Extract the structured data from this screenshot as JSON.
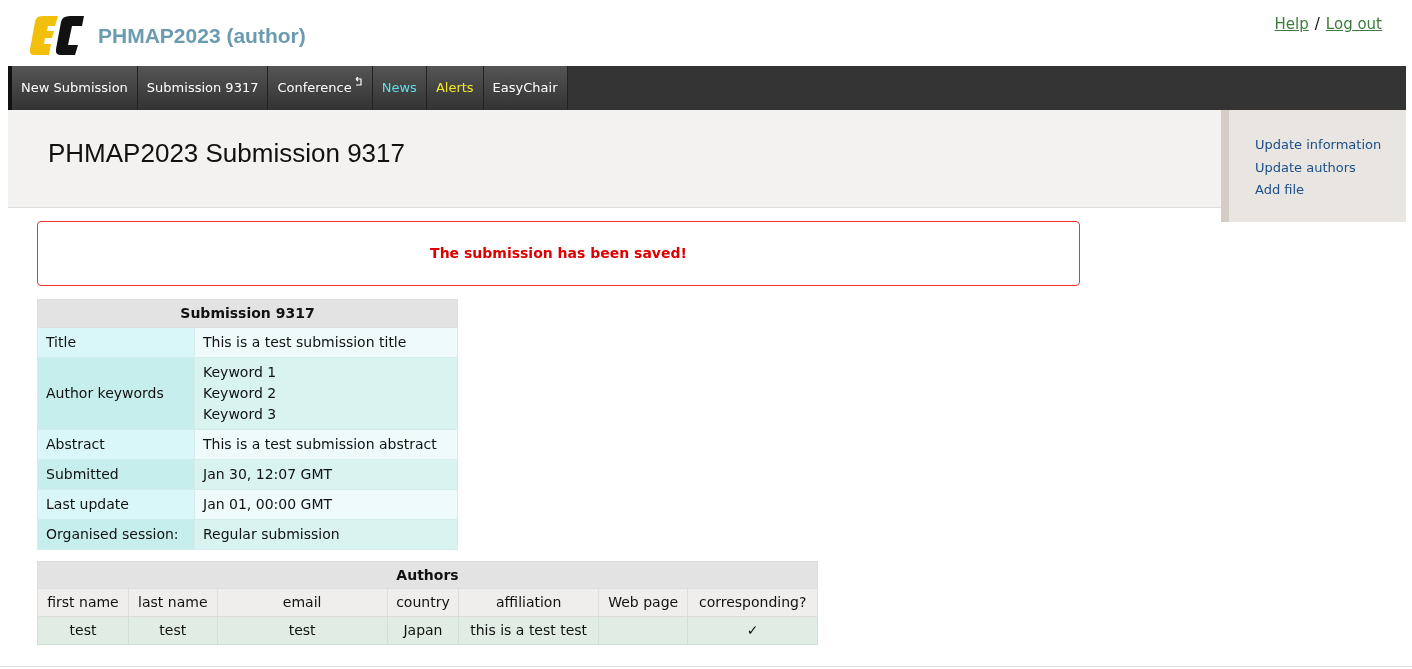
{
  "header": {
    "title": "PHMAP2023 (author)",
    "links": [
      "Help",
      "Log out"
    ],
    "separator": "/"
  },
  "nav": [
    {
      "label": "New Submission",
      "kind": "plain"
    },
    {
      "label": "Submission 9317",
      "kind": "plain"
    },
    {
      "label": "Conference",
      "kind": "return"
    },
    {
      "label": "News",
      "kind": "news"
    },
    {
      "label": "Alerts",
      "kind": "alerts"
    },
    {
      "label": "EasyChair",
      "kind": "plain"
    }
  ],
  "page_title": "PHMAP2023 Submission 9317",
  "side_menu": [
    "Update information",
    "Update authors",
    "Add file"
  ],
  "notice": "The submission has been saved!",
  "info_table": {
    "title": "Submission 9317",
    "rows": [
      {
        "label": "Title",
        "values": [
          "This is a test submission title"
        ]
      },
      {
        "label": "Author keywords",
        "values": [
          "Keyword 1",
          "Keyword 2",
          "Keyword 3"
        ]
      },
      {
        "label": "Abstract",
        "values": [
          "This is a test submission abstract"
        ]
      },
      {
        "label": "Submitted",
        "values": [
          "Jan 30, 12:07 GMT"
        ]
      },
      {
        "label": "Last update",
        "values": [
          "Jan 01, 00:00 GMT"
        ]
      },
      {
        "label": "Organised session:",
        "values": [
          "Regular submission"
        ]
      }
    ]
  },
  "authors_table": {
    "title": "Authors",
    "columns": [
      "first name",
      "last name",
      "email",
      "country",
      "affiliation",
      "Web page",
      "corresponding?"
    ],
    "rows": [
      [
        "test",
        "test",
        "test",
        "Japan",
        "this is a test test",
        "",
        "✓"
      ]
    ]
  }
}
